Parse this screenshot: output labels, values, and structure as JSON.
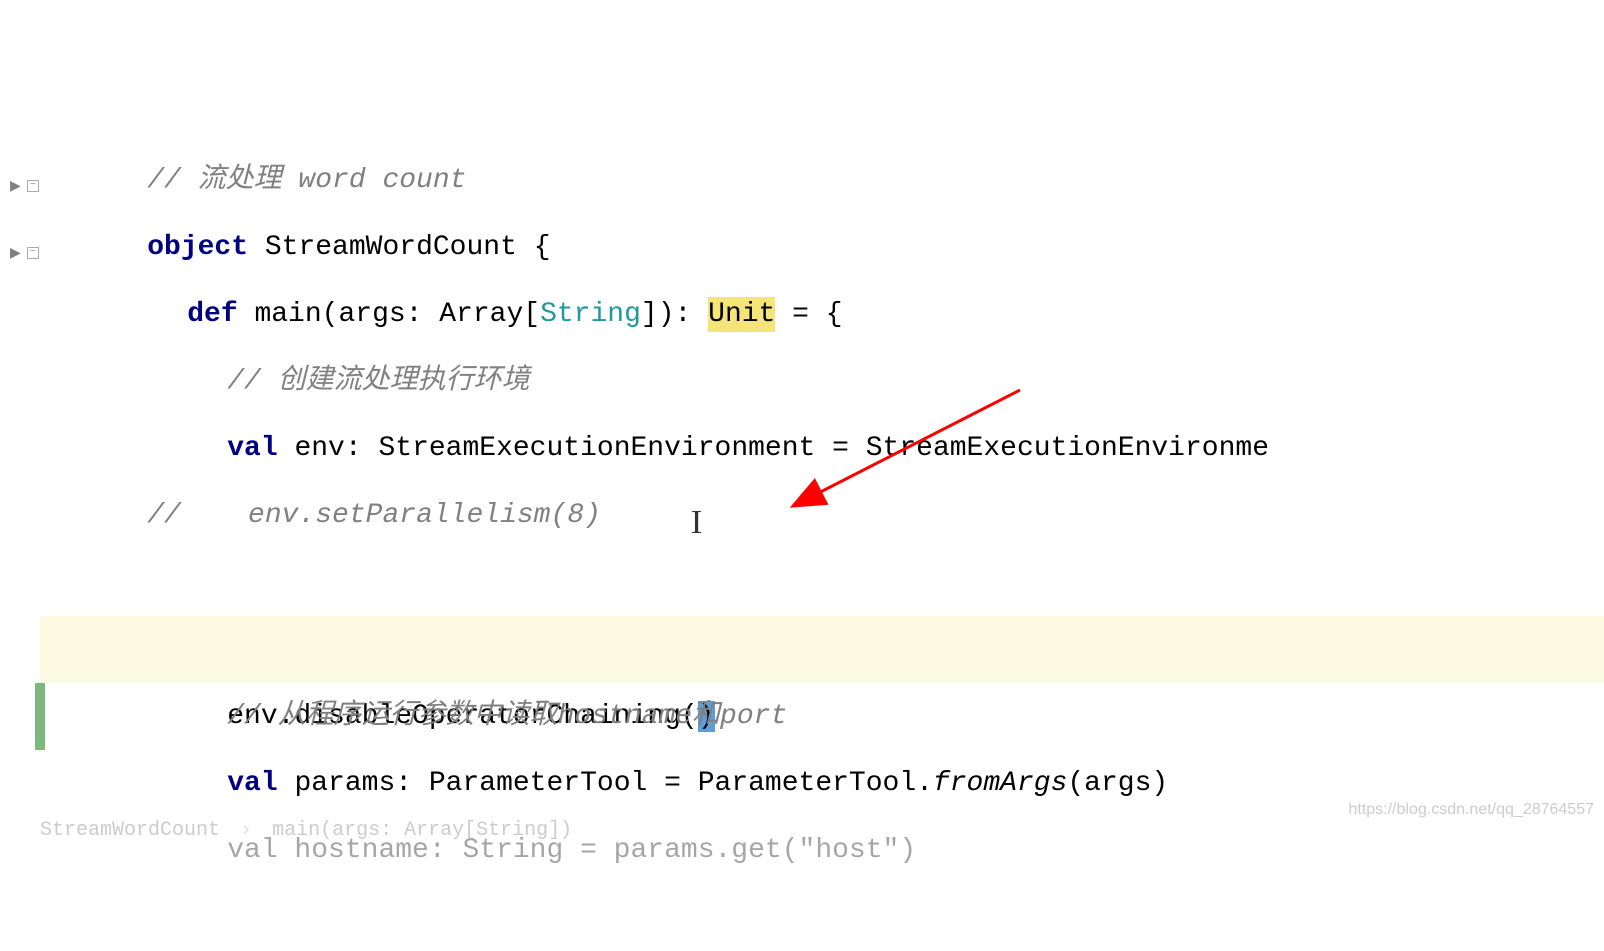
{
  "code": {
    "line1_comment": "// 流处理 word count",
    "line2_object": "object",
    "line2_name": " StreamWordCount {",
    "line3_def": "def",
    "line3_main": " main(args: Array[",
    "line3_string": "String",
    "line3_mid": "]): ",
    "line3_unit": "Unit",
    "line3_end": " = {",
    "line4_comment": "// 创建流处理执行环境",
    "line5_val": "val",
    "line5_rest": " env: StreamExecutionEnvironment = StreamExecutionEnvironme",
    "line6_comment": "//    env.setParallelism(8)",
    "line7_code": "env.disableOperatorChaining(",
    "line7_selected": ")",
    "line9_comment": "// 从程序运行参数中读取hostname和port",
    "line10_val": "val",
    "line10_rest": " params: ParameterTool = ParameterTool.",
    "line10_method": "fromArgs",
    "line10_end": "(args)",
    "line11_faded": "val hostname: String = params.get(\"host\")"
  },
  "breadcrumb": {
    "item1": "StreamWordCount",
    "item2": "main(args: Array[String])"
  },
  "watermark": "https://blog.csdn.net/qq_28764557"
}
